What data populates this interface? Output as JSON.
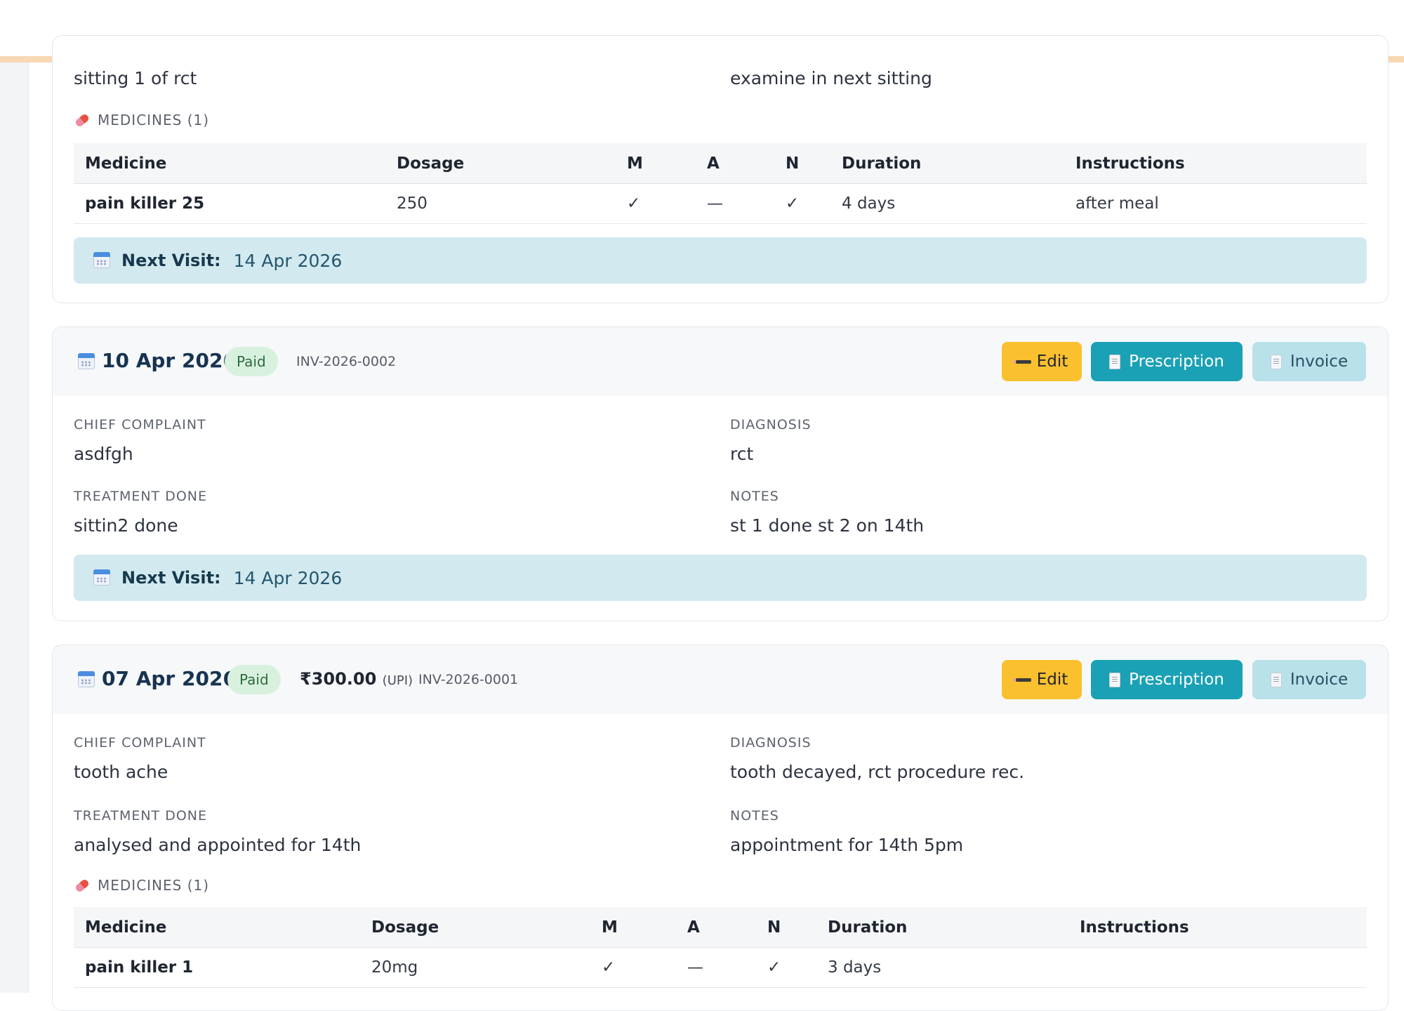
{
  "partial_top": {
    "treatment_done": "sitting 1 of rct",
    "notes": "examine in next sitting",
    "medicines_title": "MEDICINES (1)",
    "columns": [
      "Medicine",
      "Dosage",
      "M",
      "A",
      "N",
      "Duration",
      "Instructions"
    ],
    "medicines": [
      {
        "name": "pain killer 25",
        "dosage": "250",
        "m": "✓",
        "a": "—",
        "n": "✓",
        "duration": "4 days",
        "instructions": "after meal"
      }
    ],
    "next_visit_label": "Next Visit:",
    "next_visit_date": "14 Apr 2026"
  },
  "visit_2": {
    "date": "10 Apr 2026",
    "status": "Paid",
    "invoice_no": "INV-2026-0002",
    "edit_label": "Edit",
    "prescription_label": "Prescription",
    "invoice_label": "Invoice",
    "chief_complaint_label": "CHIEF COMPLAINT",
    "chief_complaint": "asdfgh",
    "diagnosis_label": "DIAGNOSIS",
    "diagnosis": "rct",
    "treatment_label": "TREATMENT DONE",
    "treatment": "sittin2 done",
    "notes_label": "NOTES",
    "notes": "st 1 done st 2 on 14th",
    "next_visit_label": "Next Visit:",
    "next_visit_date": "14 Apr 2026"
  },
  "visit_3": {
    "date": "07 Apr 2026",
    "status": "Paid",
    "amount": "₹300.00",
    "payment_mode": "(UPI)",
    "invoice_no": "INV-2026-0001",
    "edit_label": "Edit",
    "prescription_label": "Prescription",
    "invoice_label": "Invoice",
    "chief_complaint_label": "CHIEF COMPLAINT",
    "chief_complaint": "tooth ache",
    "diagnosis_label": "DIAGNOSIS",
    "diagnosis": "tooth decayed, rct procedure rec.",
    "treatment_label": "TREATMENT DONE",
    "treatment": "analysed and appointed for 14th",
    "notes_label": "NOTES",
    "notes": "appointment for 14th 5pm",
    "medicines_title": "MEDICINES (1)",
    "columns": [
      "Medicine",
      "Dosage",
      "M",
      "A",
      "N",
      "Duration",
      "Instructions"
    ],
    "medicines": [
      {
        "name": "pain killer 1",
        "dosage": "20mg",
        "m": "✓",
        "a": "—",
        "n": "✓",
        "duration": "3 days",
        "instructions": ""
      }
    ]
  }
}
